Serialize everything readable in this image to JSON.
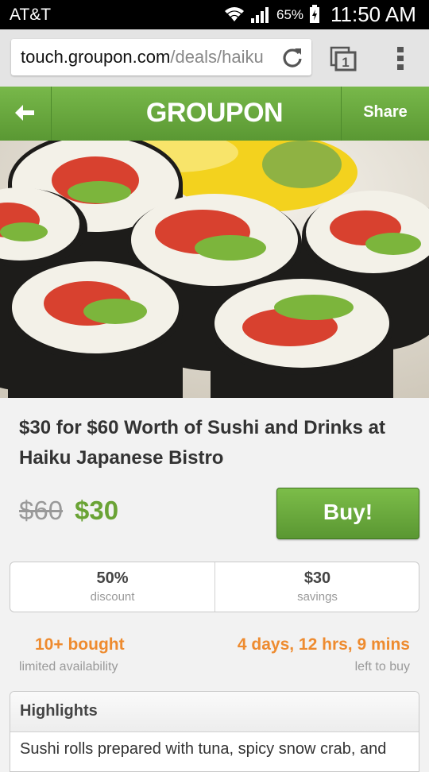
{
  "status_bar": {
    "carrier": "AT&T",
    "battery_percent": "65%",
    "time": "11:50 AM",
    "icons": [
      "wifi-icon",
      "signal-icon",
      "battery-charging-icon"
    ]
  },
  "browser": {
    "url_host": "touch.groupon.com",
    "url_path": "/deals/haiku",
    "tab_count": "1",
    "icons": [
      "reload-icon",
      "tabs-icon",
      "overflow-menu-icon"
    ]
  },
  "header": {
    "logo": "GROUPON",
    "share_label": "Share",
    "back_icon": "back-arrow-icon"
  },
  "deal": {
    "title": "$30 for $60 Worth of Sushi and Drinks at Haiku Japanese Bistro",
    "original_price": "$60",
    "price": "$30",
    "buy_label": "Buy!",
    "discount_value": "50%",
    "discount_label": "discount",
    "savings_value": "$30",
    "savings_label": "savings",
    "bought": "10+ bought",
    "availability": "limited availability",
    "time_left": "4 days, 12 hrs, 9 mins",
    "time_left_label": "left to buy"
  },
  "highlights": {
    "heading": "Highlights",
    "text": "Sushi rolls prepared with tuna, spicy snow crab, and"
  },
  "colors": {
    "brand_green": "#62a239",
    "accent_orange": "#ee8b2f",
    "price_green": "#6aa335"
  }
}
